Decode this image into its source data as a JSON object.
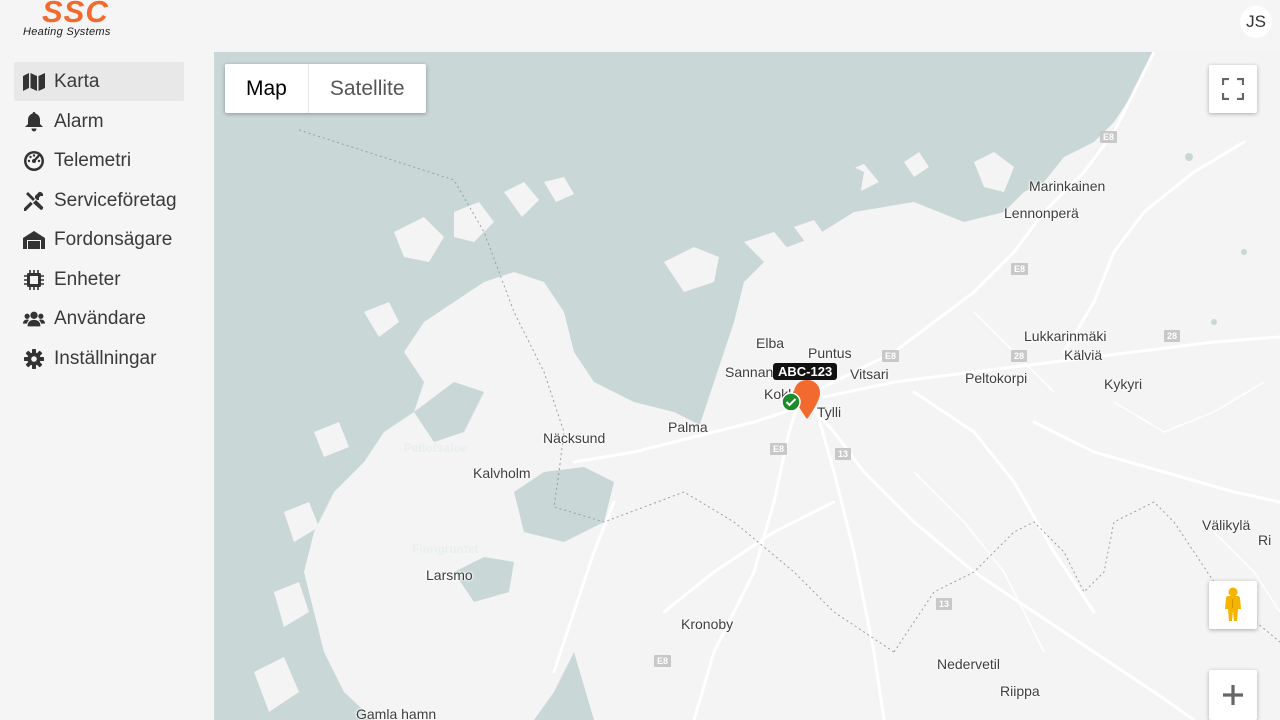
{
  "brand": {
    "name": "SSC",
    "tagline": "Heating Systems"
  },
  "user": {
    "initials": "JS"
  },
  "nav": [
    {
      "label": "Karta",
      "icon": "map-icon",
      "active": true
    },
    {
      "label": "Alarm",
      "icon": "bell-icon",
      "active": false
    },
    {
      "label": "Telemetri",
      "icon": "gauge-icon",
      "active": false
    },
    {
      "label": "Serviceföretag",
      "icon": "tools-icon",
      "active": false
    },
    {
      "label": "Fordonsägare",
      "icon": "warehouse-icon",
      "active": false
    },
    {
      "label": "Enheter",
      "icon": "chip-icon",
      "active": false
    },
    {
      "label": "Användare",
      "icon": "users-icon",
      "active": false
    },
    {
      "label": "Inställningar",
      "icon": "cog-icon",
      "active": false
    }
  ],
  "map": {
    "type_control": {
      "map_label": "Map",
      "satellite_label": "Satellite",
      "selected": "Map"
    },
    "places": {
      "marinkainen": "Marinkainen",
      "lennonpera": "Lennonperä",
      "lukkarinmaki": "Lukkarinmäki",
      "kalvia": "Kälviä",
      "kykyri": "Kykyri",
      "peltokorpi": "Peltokorpi",
      "elba": "Elba",
      "puntus": "Puntus",
      "sannan": "Sannan",
      "vitsari": "Vitsari",
      "kokkola": "Kokkola",
      "tylli": "Tylli",
      "palma": "Palma",
      "nacksund": "Näcksund",
      "kalvholm": "Kalvholm",
      "larsmo": "Larsmo",
      "kronoby": "Kronoby",
      "nedervetil": "Nedervetil",
      "riippa": "Riippa",
      "valikyla": "Välikylä",
      "ri": "Ri",
      "gamla_hamn": "Gamla hamn",
      "pellotsalo": "Pellotsaloe",
      "finngruntet": "Finngruntet"
    },
    "road_shields": {
      "e8": "E8",
      "r13": "13",
      "r28": "28"
    },
    "vehicle": {
      "label": "ABC-123",
      "status": "ok",
      "marker_color": "#f26a2e",
      "status_color": "#1e8c2a"
    }
  },
  "colors": {
    "accent": "#f26a2e",
    "water": "#c9d7d6",
    "land": "#f4f4f4",
    "road": "#ffffff"
  }
}
